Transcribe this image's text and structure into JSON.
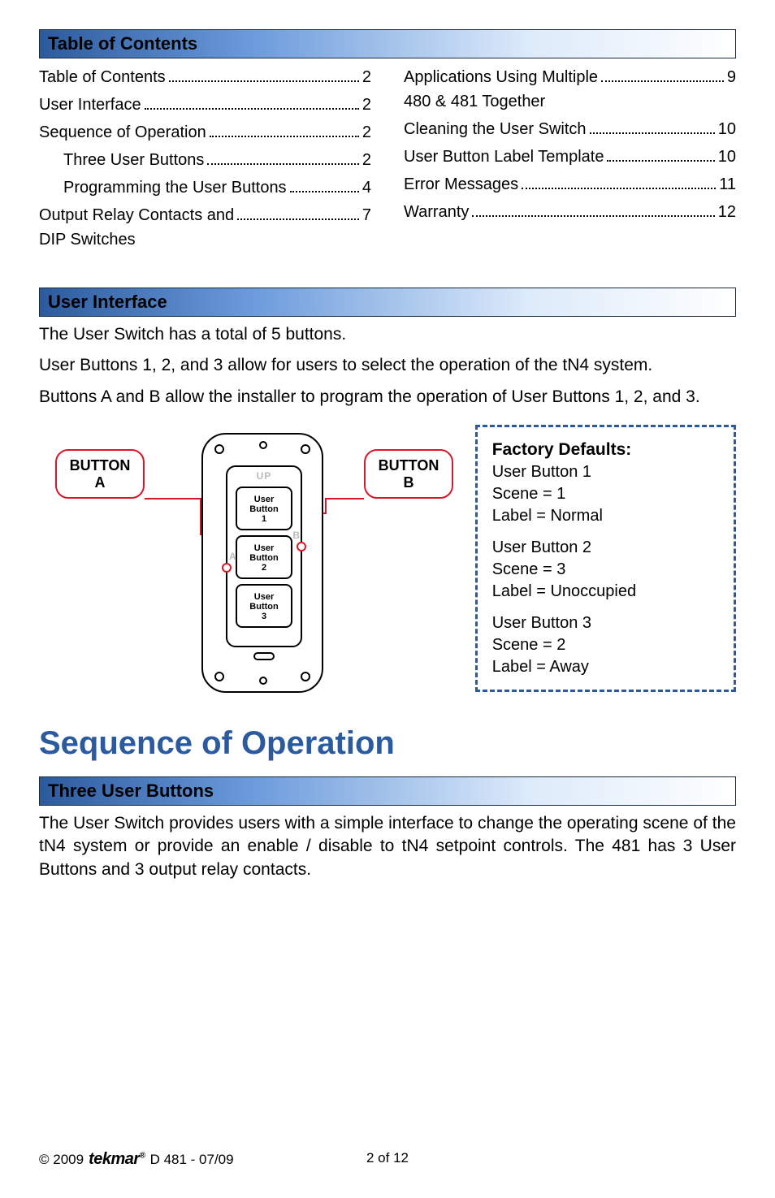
{
  "headers": {
    "toc": "Table of Contents",
    "user_interface": "User Interface",
    "three_user_buttons": "Three User Buttons"
  },
  "main_title": "Sequence of Operation",
  "toc": {
    "left": [
      {
        "label": "Table of Contents",
        "page": "2",
        "indent": false
      },
      {
        "label": "User Interface",
        "page": "2",
        "indent": false
      },
      {
        "label": "Sequence of Operation",
        "page": "2",
        "indent": false
      },
      {
        "label": "Three User Buttons",
        "page": "2",
        "indent": true
      },
      {
        "label": "Programming the User Buttons",
        "page": "4",
        "indent": true
      },
      {
        "label": "Output Relay Contacts and DIP Switches",
        "page": "7",
        "indent": false
      }
    ],
    "right": [
      {
        "label": "Applications Using Multiple 480 & 481 Together",
        "page": "9",
        "indent": false
      },
      {
        "label": "Cleaning the User Switch",
        "page": "10",
        "indent": false
      },
      {
        "label": "User Button Label Template",
        "page": "10",
        "indent": false
      },
      {
        "label": "Error Messages",
        "page": "11",
        "indent": false
      },
      {
        "label": "Warranty",
        "page": "12",
        "indent": false
      }
    ]
  },
  "user_interface_text": {
    "p1": "The User Switch has a total of 5 buttons.",
    "p2": "User Buttons 1, 2, and 3 allow for users to select the operation of the tN4 system.",
    "p3": "Buttons A and B allow the installer to program the operation of User Buttons 1, 2, and 3."
  },
  "diagram": {
    "button_a_line1": "BUTTON",
    "button_a_line2": "A",
    "button_b_line1": "BUTTON",
    "button_b_line2": "B",
    "up": "UP",
    "a": "A",
    "b": "B",
    "ub1_l1": "User",
    "ub1_l2": "Button",
    "ub1_l3": "1",
    "ub2_l1": "User",
    "ub2_l2": "Button",
    "ub2_l3": "2",
    "ub3_l1": "User",
    "ub3_l2": "Button",
    "ub3_l3": "3"
  },
  "defaults": {
    "title": "Factory Defaults:",
    "b1_name": "User Button 1",
    "b1_scene": "Scene  =   1",
    "b1_label": "Label   =   Normal",
    "b2_name": "User Button 2",
    "b2_scene": "Scene  =   3",
    "b2_label": "Label   =   Unoccupied",
    "b3_name": "User Button 3",
    "b3_scene": "Scene  =   2",
    "b3_label": "Label   =   Away"
  },
  "three_user_text": "The User Switch provides users with a simple interface to change the operating scene of the tN4 system or provide an enable / disable to tN4 setpoint controls. The 481 has 3 User Buttons and 3 output relay contacts.",
  "footer": {
    "copyright": "© 2009",
    "brand": "tekmar",
    "reg": "®",
    "doc": "D 481 - 07/09",
    "page": "2 of 12"
  }
}
